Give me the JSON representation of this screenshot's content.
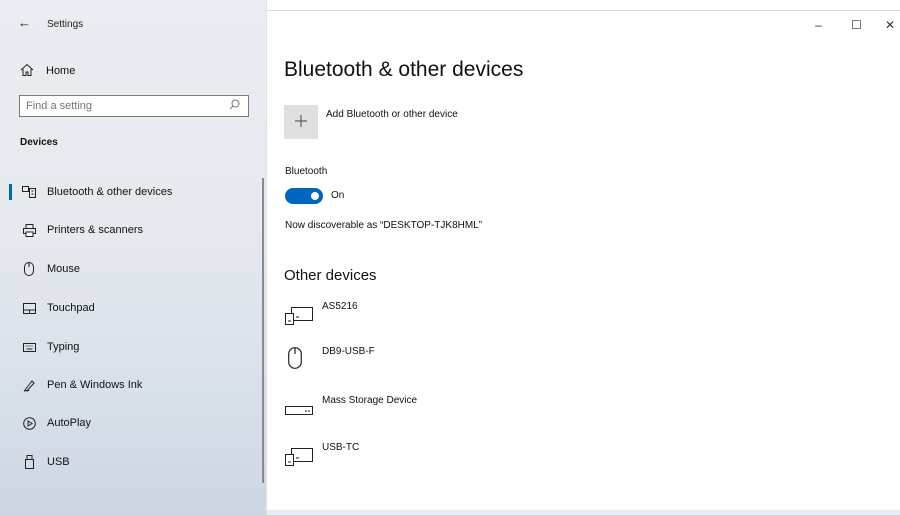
{
  "window": {
    "title": "Settings",
    "back_glyph": "←",
    "minimize_glyph": "–",
    "maximize_glyph": "☐",
    "close_glyph": "✕"
  },
  "sidebar": {
    "home_label": "Home",
    "search_placeholder": "Find a setting",
    "section_label": "Devices",
    "items": [
      {
        "label": "Bluetooth & other devices",
        "icon": "bluetooth-devices-icon",
        "active": true
      },
      {
        "label": "Printers & scanners",
        "icon": "printer-icon",
        "active": false
      },
      {
        "label": "Mouse",
        "icon": "mouse-icon",
        "active": false
      },
      {
        "label": "Touchpad",
        "icon": "touchpad-icon",
        "active": false
      },
      {
        "label": "Typing",
        "icon": "keyboard-icon",
        "active": false
      },
      {
        "label": "Pen & Windows Ink",
        "icon": "pen-icon",
        "active": false
      },
      {
        "label": "AutoPlay",
        "icon": "autoplay-icon",
        "active": false
      },
      {
        "label": "USB",
        "icon": "usb-icon",
        "active": false
      }
    ]
  },
  "main": {
    "title": "Bluetooth & other devices",
    "add_device_label": "Add Bluetooth or other device",
    "bluetooth_heading": "Bluetooth",
    "bluetooth_state": "On",
    "discoverable_text": "Now discoverable as “DESKTOP-TJK8HML”",
    "other_devices_title": "Other devices",
    "devices": [
      {
        "name": "AS5216",
        "icon": "device-icon"
      },
      {
        "name": "DB9-USB-F",
        "icon": "mouse-icon"
      },
      {
        "name": "Mass Storage Device",
        "icon": "drive-icon"
      },
      {
        "name": "USB-TC",
        "icon": "device-icon"
      }
    ]
  },
  "colors": {
    "accent": "#0067c0",
    "sidebar_bg": "#e6eaee"
  }
}
